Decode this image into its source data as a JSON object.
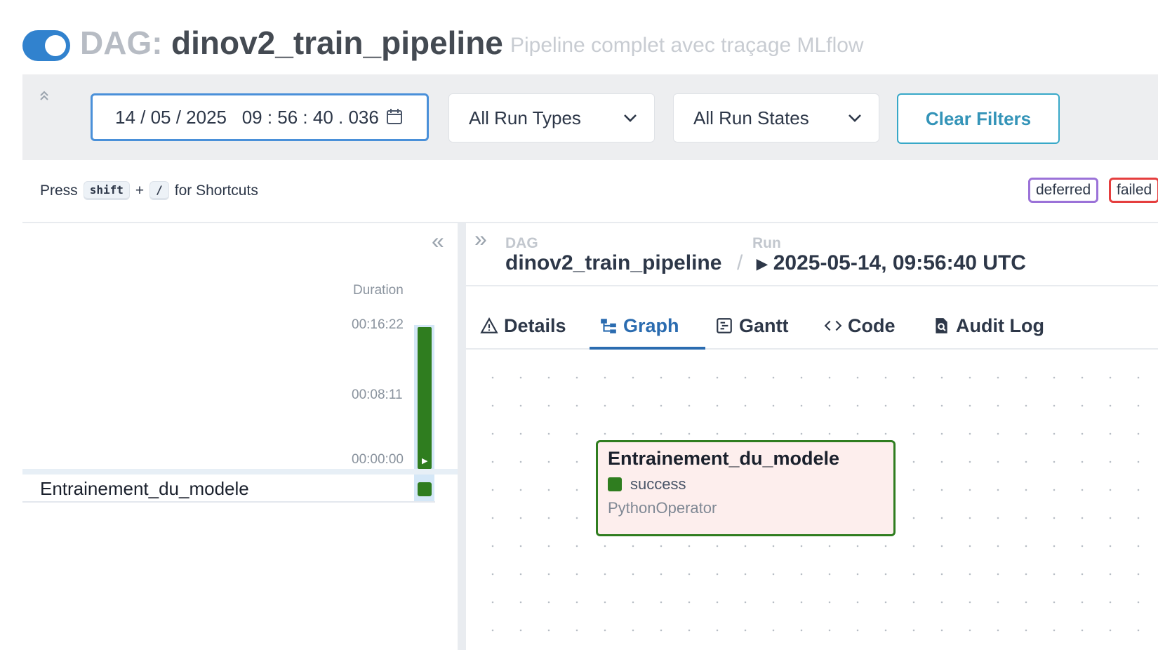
{
  "header": {
    "dag_prefix": "DAG:",
    "dag_id": "dinov2_train_pipeline",
    "description": "Pipeline complet avec traçage MLflow",
    "toggle_on": true
  },
  "filters": {
    "datetime": "14 / 05 / 2025   09 : 56 : 40 . 036",
    "run_type": "All Run Types",
    "run_state": "All Run States",
    "clear_label": "Clear Filters"
  },
  "shortcuts": {
    "press": "Press",
    "key1": "shift",
    "plus": "+",
    "key2": "/",
    "suffix": "for Shortcuts"
  },
  "legend": {
    "deferred": "deferred",
    "failed": "failed"
  },
  "grid": {
    "duration_header": "Duration",
    "ticks": [
      "00:16:22",
      "00:08:11",
      "00:00:00"
    ],
    "tasks": [
      {
        "name": "Entrainement_du_modele",
        "state": "success"
      }
    ],
    "colors": {
      "success": "#2f7d1f"
    }
  },
  "breadcrumb": {
    "dag_label": "DAG",
    "dag_value": "dinov2_train_pipeline",
    "separator": "/",
    "run_label": "Run",
    "run_value": "2025-05-14, 09:56:40 UTC"
  },
  "tabs": [
    {
      "label": "Details",
      "icon": "warning-triangle-icon"
    },
    {
      "label": "Graph",
      "icon": "graph-icon",
      "active": true
    },
    {
      "label": "Gantt",
      "icon": "gantt-icon"
    },
    {
      "label": "Code",
      "icon": "code-icon"
    },
    {
      "label": "Audit Log",
      "icon": "audit-log-icon"
    }
  ],
  "graph": {
    "node": {
      "title": "Entrainement_du_modele",
      "state": "success",
      "operator": "PythonOperator"
    }
  }
}
